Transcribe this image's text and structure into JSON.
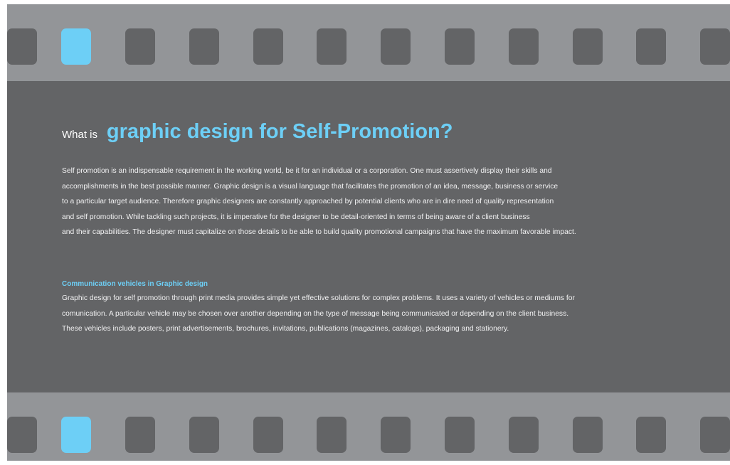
{
  "colors": {
    "film_border": "#939598",
    "content_background": "#636466",
    "sprocket_hole": "#636466",
    "accent": "#6dcff6",
    "body_text": "#f1f1f2"
  },
  "heading": {
    "lead": "What is",
    "main": "graphic design for Self-Promotion?"
  },
  "intro": {
    "lines": [
      "Self promotion is an indispensable requirement in the working world, be it for an individual or a corporation. One must assertively display their skills and",
      "accomplishments in the best possible manner. Graphic design is a visual language that facilitates the promotion of an idea, message, business or service",
      "to a particular target audience. Therefore graphic designers are constantly approached by potential clients who are in dire need of quality representation",
      "and self promotion. While tackling such projects, it is imperative for the designer to be detail-oriented in terms of being aware of a client business",
      "and their capabilities. The designer must capitalize on those details to be able to build quality promotional campaigns that have the maximum favorable impact."
    ]
  },
  "section": {
    "title": "Communication vehicles in Graphic design",
    "lines": [
      "Graphic design for self promotion through print media provides simple yet effective solutions for complex problems. It uses a variety of vehicles or mediums for",
      "comunication. A particular vehicle may be chosen over another depending on the type of message being communicated or depending on the client business.",
      "These vehicles include posters, print advertisements, brochures, invitations, publications (magazines, catalogs), packaging and stationery."
    ]
  }
}
